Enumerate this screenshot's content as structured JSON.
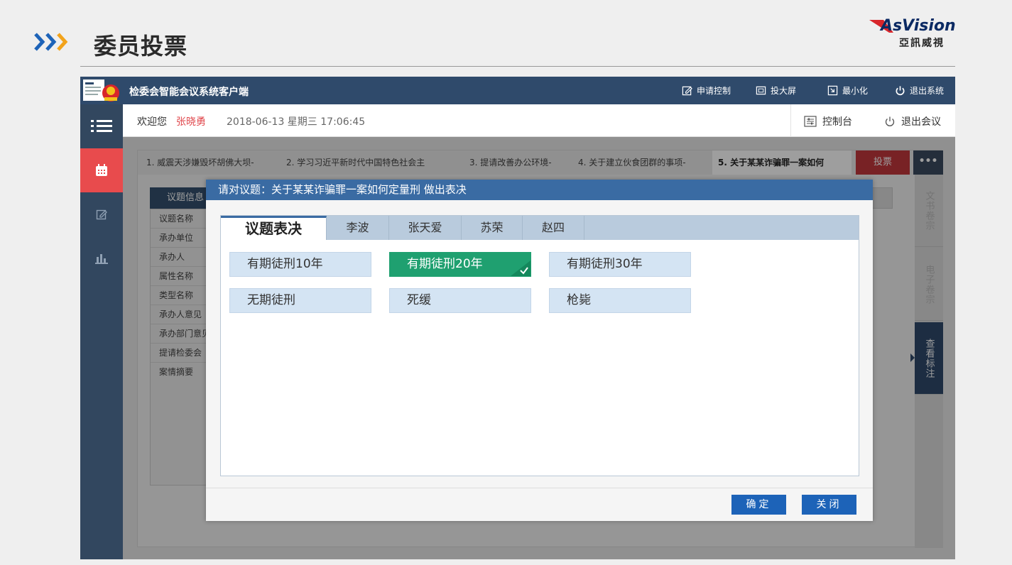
{
  "slide": {
    "title": "委员投票",
    "logo_main": "AsVision",
    "logo_sub": "亞訊威視"
  },
  "app": {
    "title": "检委会智能会议系统客户端",
    "toolbar": {
      "request_control": "申请控制",
      "project": "投大屏",
      "minimize": "最小化",
      "exit_system": "退出系统"
    },
    "user": {
      "welcome": "欢迎您",
      "name": "张晓勇",
      "datetime": "2018-06-13 星期三 17:06:45",
      "console": "控制台",
      "exit_meeting": "退出会议"
    },
    "topic_tabs": [
      "1. 威震天涉嫌毁坏胡佛大坝-",
      "2. 学习习近平新时代中国特色社会主",
      "3. 提请改善办公环境-",
      "4. 关于建立伙食团群的事项-",
      "5. 关于某某诈骗罪一案如何"
    ],
    "vote_tab": "投票",
    "more_tab": "•••",
    "info": {
      "header": "议题信息",
      "rows": [
        "议题名称",
        "承办单位",
        "承办人",
        "属性名称",
        "类型名称",
        "承办人意见",
        "承办部门意见",
        "提请检委会",
        "案情摘要"
      ]
    },
    "rail": [
      "文书卷宗",
      "电子卷宗",
      "查看标注"
    ]
  },
  "modal": {
    "title": "请对议题：关于某某诈骗罪一案如何定量刑 做出表决",
    "tabs": [
      "议题表决",
      "李波",
      "张天爱",
      "苏荣",
      "赵四"
    ],
    "options": [
      "有期徒刑10年",
      "有期徒刑20年",
      "有期徒刑30年",
      "无期徒刑",
      "死缓",
      "枪毙"
    ],
    "selected_option": "有期徒刑20年",
    "confirm": "确定",
    "close": "关闭"
  },
  "colors": {
    "titlebar": "#2f4a6b",
    "sidebar": "#32475f",
    "sidebar_active": "#e84b4d",
    "modal_header": "#3a6ba3",
    "option_bg": "#d4e4f3",
    "option_selected": "#1fa070",
    "button": "#1d63b8",
    "vote_tab": "#c2373c"
  }
}
